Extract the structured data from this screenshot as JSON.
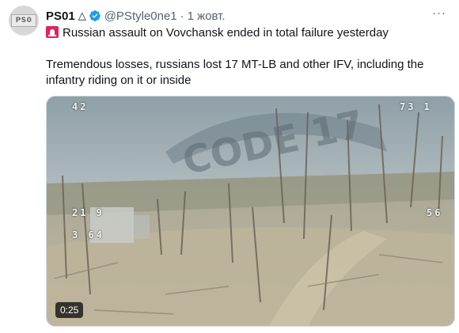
{
  "tweet": {
    "author_name": "PS01",
    "author_glyph": "△",
    "handle": "@PStyle0ne1",
    "separator": "·",
    "time": "1 жовт.",
    "more": "···",
    "avatar_text": "PS0",
    "line1": "Russian assault on Vovchansk ended in total failure yesterday",
    "line2": "Tremendous losses, russians lost 17 MT-LB and other IFV, including the infantry riding on it or inside",
    "icons": [
      "verified-icon",
      "siren-icon",
      "more-icon"
    ],
    "colors": {
      "verified": "#1d9bf0",
      "siren": "#e0245e",
      "secondary": "#536471"
    }
  },
  "video": {
    "duration": "0:25",
    "watermark": "CODE 17",
    "osd_top_left": "42",
    "osd_top_right": "73 1",
    "osd_left_1": "21 9",
    "osd_left_2": "3 64",
    "osd_right": "56"
  }
}
